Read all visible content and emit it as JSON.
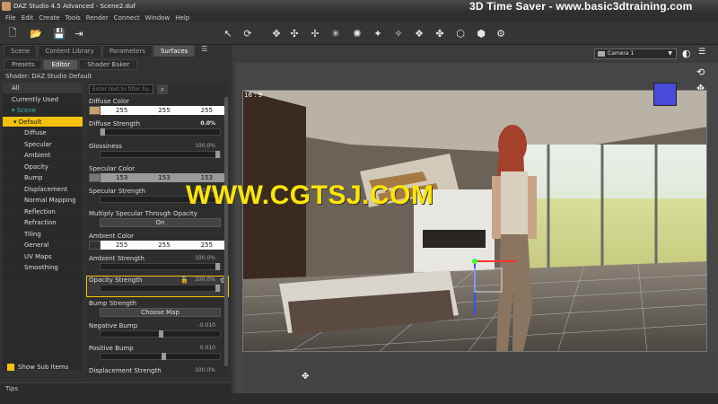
{
  "window": {
    "title": "DAZ Studio 4.5 Advanced - Scene2.duf",
    "watermark": "3D Time Saver - www.basic3dtraining.com"
  },
  "menu": [
    "File",
    "Edit",
    "Create",
    "Tools",
    "Render",
    "Connect",
    "Window",
    "Help"
  ],
  "tabs": {
    "top": [
      "Scene",
      "Content Library",
      "Parameters",
      "Surfaces"
    ],
    "active_top": "Surfaces",
    "sub": [
      "Presets",
      "Editor",
      "Shader Baker"
    ],
    "active_sub": "Editor"
  },
  "shader_label": "Shader: DAZ Studio Default",
  "surface_list": {
    "all": "All",
    "currently_used": "Currently Used",
    "scene": "▾ Scene",
    "selected": "▾ Default",
    "items": [
      "Diffuse",
      "Specular",
      "Ambient",
      "Opacity",
      "Bump",
      "Displacement",
      "Normal Mapping",
      "Reflection",
      "Refraction",
      "Tiling",
      "General",
      "UV Maps",
      "Smoothing"
    ]
  },
  "show_sub_items": "Show Sub Items",
  "filter": {
    "placeholder": "Enter text to filter by..."
  },
  "properties": {
    "diffuse_color": {
      "label": "Diffuse Color",
      "r": "255",
      "g": "255",
      "b": "255"
    },
    "diffuse_strength": {
      "label": "Diffuse Strength",
      "value": "0.0%"
    },
    "glossiness": {
      "label": "Glossiness",
      "value": "100.0%"
    },
    "specular_color": {
      "label": "Specular Color",
      "r": "153",
      "g": "153",
      "b": "153"
    },
    "specular_strength": {
      "label": "Specular Strength",
      "value": "100.0%"
    },
    "multiply_specular": {
      "label": "Multiply Specular Through Opacity",
      "button": "On"
    },
    "ambient_color": {
      "label": "Ambient Color",
      "r": "255",
      "g": "255",
      "b": "255"
    },
    "ambient_strength": {
      "label": "Ambient Strength",
      "value": "100.0%"
    },
    "opacity_strength": {
      "label": "Opacity Strength",
      "value": "100.0%"
    },
    "bump_strength": {
      "label": "Bump Strength",
      "button": "Choose Map"
    },
    "negative_bump": {
      "label": "Negative Bump",
      "value": "-0.010"
    },
    "positive_bump": {
      "label": "Positive Bump",
      "value": "0.010"
    },
    "displacement_strength": {
      "label": "Displacement Strength",
      "value": "100.0%"
    }
  },
  "tips": "Tips",
  "viewport": {
    "camera": "Camera 1",
    "aspect": "16 : 9"
  },
  "overlay_watermark": "WWW.CGTSJ.COM",
  "colors": {
    "accent": "#f4c20a",
    "panel": "#323232",
    "watermark_yellow": "#ffe500"
  }
}
